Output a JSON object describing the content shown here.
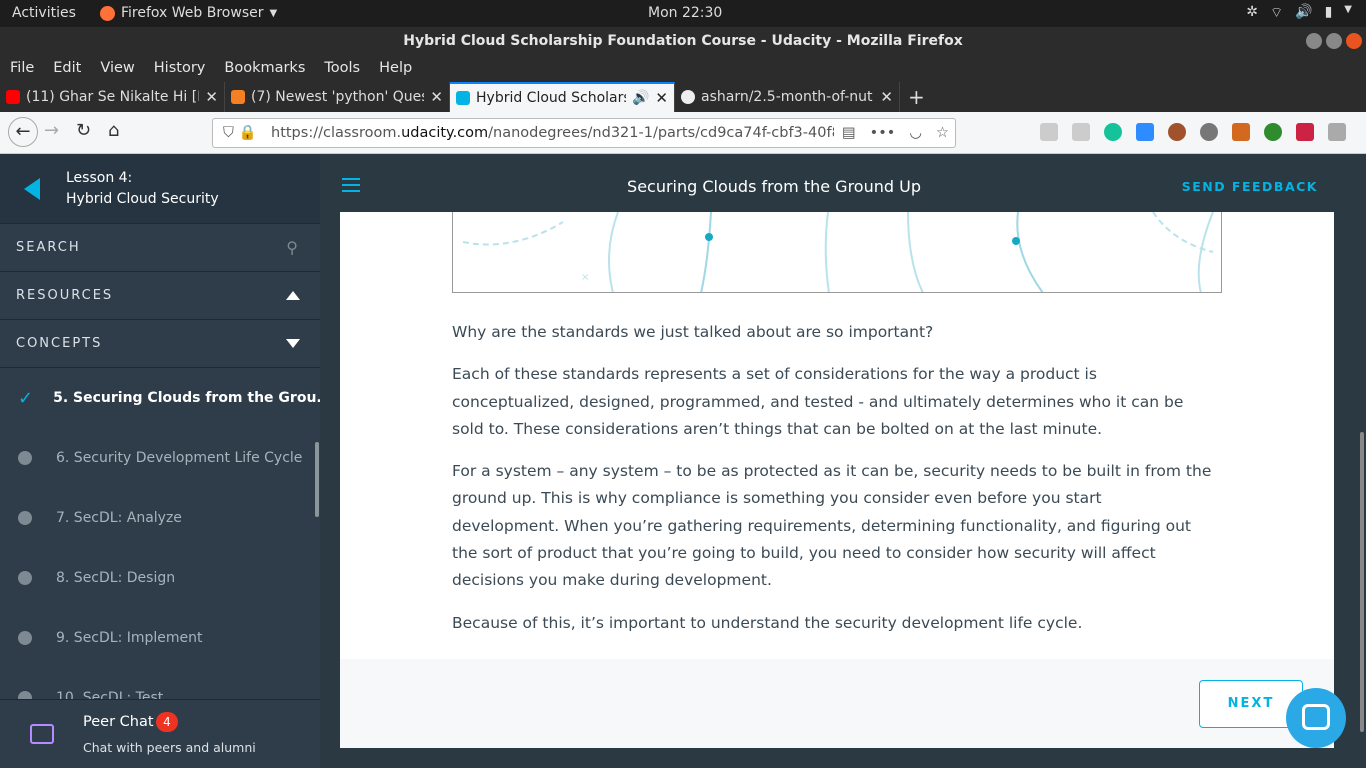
{
  "system": {
    "activities": "Activities",
    "app": "Firefox Web Browser",
    "clock": "Mon 22:30"
  },
  "window": {
    "title": "Hybrid Cloud Scholarship Foundation Course - Udacity - Mozilla Firefox"
  },
  "menu": [
    "File",
    "Edit",
    "View",
    "History",
    "Bookmarks",
    "Tools",
    "Help"
  ],
  "tabs": [
    {
      "label": "(11) Ghar Se Nikalte Hi [F",
      "icon": "youtube-icon",
      "color": "#ff0000"
    },
    {
      "label": "(7) Newest 'python' Ques",
      "icon": "stackoverflow-icon",
      "color": "#f48024"
    },
    {
      "label": "Hybrid Cloud Scholars",
      "icon": "udacity-icon",
      "color": "#02b3e4",
      "audio": "🔊"
    },
    {
      "label": "asharn/2.5-month-of-nut",
      "icon": "github-icon",
      "color": "#333333"
    }
  ],
  "url": {
    "prefix": "https://classroom.",
    "domain": "udacity.com",
    "rest": "/nanodegrees/nd321-1/parts/cd9ca74f-cbf3-40f8"
  },
  "sidebar": {
    "lesson_label": "Lesson 4:",
    "lesson_title": "Hybrid Cloud Security",
    "search": "SEARCH",
    "resources": "RESOURCES",
    "concepts_label": "CONCEPTS",
    "concepts": [
      "5. Securing Clouds from the Grou...",
      "6. Security Development Life Cycle",
      "7. SecDL: Analyze",
      "8. SecDL: Design",
      "9. SecDL: Implement",
      "10. SecDL: Test"
    ],
    "peer_chat": "Peer Chat",
    "peer_badge": "4",
    "peer_sub": "Chat with peers and alumni"
  },
  "header": {
    "title": "Securing Clouds from the Ground Up",
    "feedback": "SEND FEEDBACK"
  },
  "content": {
    "paragraphs": [
      "Why are the standards we just talked about are so important?",
      "Each of these standards represents a set of considerations for the way a product is conceptualized, designed, programmed, and tested - and ultimately determines who it can be sold to. These considerations aren’t things that can be bolted on at the last minute.",
      "For a system – any system – to be as protected as it can be, security needs to be built in from the ground up. This is why compliance is something you consider even before you start development. When you’re gathering requirements, determining functionality, and figuring out the sort of product that you’re going to build, you need to consider how security will affect decisions you make during development.",
      "Because of this, it’s important to understand the security development life cycle."
    ],
    "next": "NEXT"
  }
}
